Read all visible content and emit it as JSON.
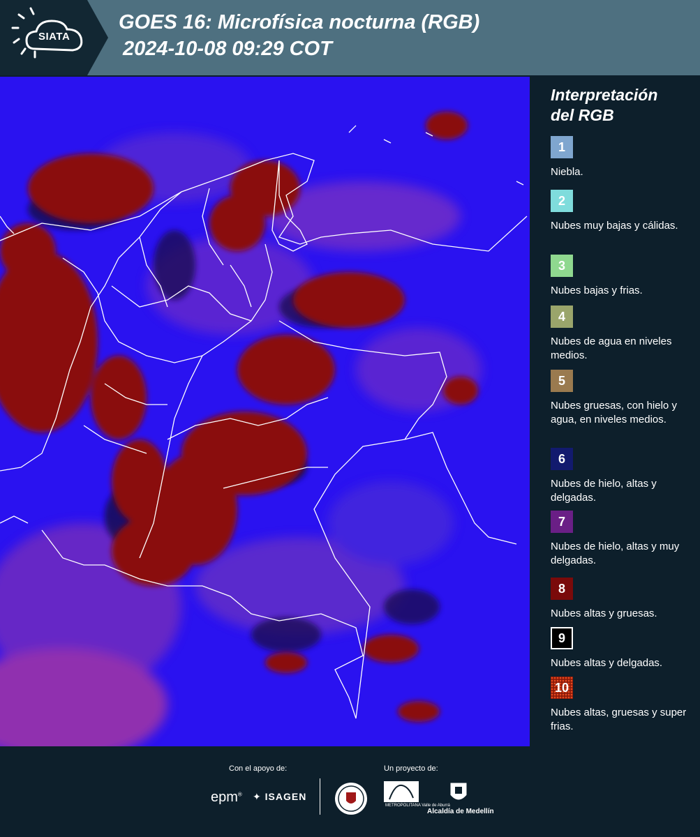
{
  "header": {
    "logo_text": "SIATA",
    "title_line1": "GOES 16: Microfísica nocturna (RGB)",
    "title_line2": "2024-10-08 09:29 COT"
  },
  "legend": {
    "title_line1": "Interpretación",
    "title_line2": "del RGB",
    "items": [
      {
        "number": "1",
        "label": "Niebla.",
        "color": "#7fa6cf"
      },
      {
        "number": "2",
        "label": "Nubes muy bajas y cálidas.",
        "color": "#7fdcdc"
      },
      {
        "number": "3",
        "label": "Nubes bajas y frias.",
        "color": "#8fd88f"
      },
      {
        "number": "4",
        "label": "Nubes de agua en niveles medios.",
        "color": "#9aa56b"
      },
      {
        "number": "5",
        "label": "Nubes gruesas, con hielo y agua, en niveles medios.",
        "color": "#9a7a4f"
      },
      {
        "number": "6",
        "label": "Nubes de hielo, altas y delgadas.",
        "color": "#121a6e"
      },
      {
        "number": "7",
        "label": "Nubes de hielo, altas y muy delgadas.",
        "color": "#6a1f86"
      },
      {
        "number": "8",
        "label": "Nubes altas y gruesas.",
        "color": "#7a0a0a"
      },
      {
        "number": "9",
        "label": "Nubes altas y delgadas.",
        "color": "#000000"
      },
      {
        "number": "10",
        "label": "Nubes altas, gruesas y super frias.",
        "color": "#8a1a0a"
      }
    ]
  },
  "footer": {
    "support_caption": "Con el apoyo de:",
    "project_caption": "Un proyecto de:",
    "epm": "epm",
    "isagen": "ISAGEN",
    "area_text": "METROPOLITANA Valle de Aburrá",
    "alcaldia": "Alcaldía de Medellín"
  },
  "colors": {
    "header_bg": "#4e7080",
    "map_base": "#2a12f0",
    "cloud_red": "#8a0c0c",
    "panel_bg": "#0d1f2b"
  }
}
